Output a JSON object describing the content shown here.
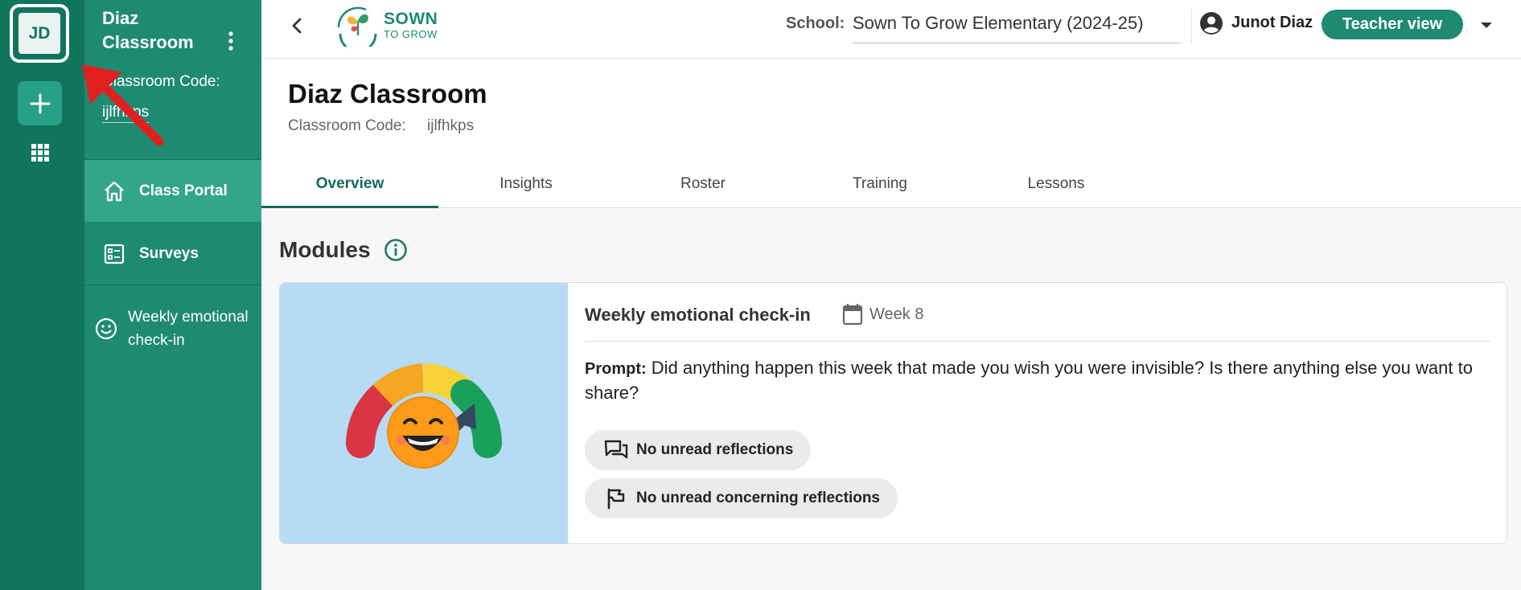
{
  "rail": {
    "avatar_initials": "JD",
    "add_icon": "plus-icon",
    "apps_icon": "apps-grid-icon"
  },
  "sidebar": {
    "classroom_title": "Diaz Classroom",
    "code_label": "Classroom Code:",
    "code_value": "ijlfhkps",
    "items": [
      {
        "label": "Class Portal",
        "icon": "home-icon",
        "active": true
      },
      {
        "label": "Surveys",
        "icon": "survey-list-icon",
        "active": false
      }
    ],
    "sub_item": {
      "label": "Weekly emotional check-in",
      "icon": "smiley-icon"
    }
  },
  "header": {
    "logo_line1": "SOWN",
    "logo_line2": "TO GROW",
    "school_label": "School:",
    "school_value": "Sown To Grow Elementary (2024-25)",
    "user_name": "Junot Diaz",
    "view_button": "Teacher view"
  },
  "page": {
    "title": "Diaz Classroom",
    "code_label": "Classroom Code:",
    "code_value": "ijlfhkps",
    "tabs": [
      "Overview",
      "Insights",
      "Roster",
      "Training",
      "Lessons"
    ],
    "active_tab": "Overview"
  },
  "modules": {
    "title": "Modules",
    "card": {
      "title": "Weekly emotional check-in",
      "week": "Week 8",
      "prompt_label": "Prompt:",
      "prompt_text": "Did anything happen this week that made you wish you were invisible? Is there anything else you want to share?",
      "pills": [
        "No unread reflections",
        "No unread concerning reflections"
      ]
    }
  },
  "colors": {
    "rail": "#11745f",
    "sidebar": "#1e8a72",
    "sidebar_active": "#33a58b",
    "accent": "#17695a",
    "card_image_bg": "#b6dbf5",
    "annotation_arrow": "#e0201f"
  }
}
